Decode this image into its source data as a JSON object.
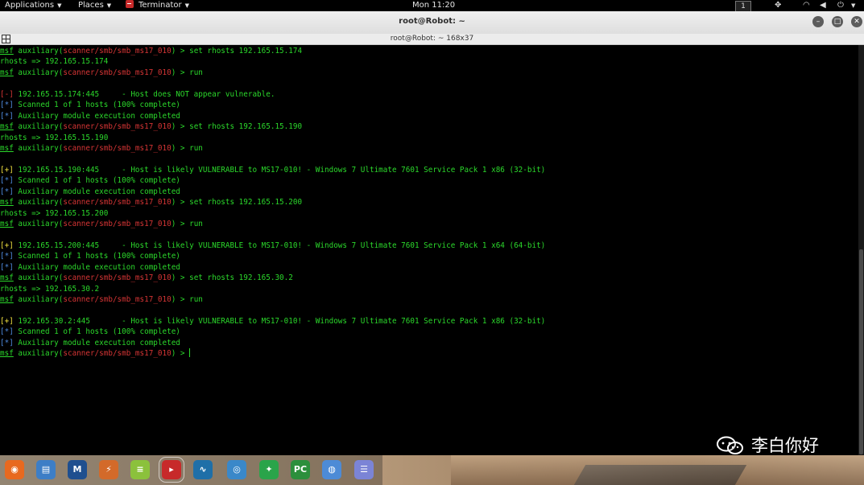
{
  "topbar": {
    "applications_label": "Applications",
    "places_label": "Places",
    "terminator_label": "Terminator",
    "clock": "Mon 11:20",
    "workspace": "1"
  },
  "window": {
    "title": "root@Robot: ~",
    "subtitle": "root@Robot: ~ 168x37"
  },
  "terminal": {
    "prompt_prefix": "msf",
    "module_word": "auxiliary",
    "module_path": "scanner/smb/smb_ms17_010",
    "lines": [
      {
        "kind": "prompt",
        "cmd": "set rhosts 192.165.15.174"
      },
      {
        "kind": "plain",
        "text": "rhosts => 192.165.15.174"
      },
      {
        "kind": "prompt",
        "cmd": "run"
      },
      {
        "kind": "blank"
      },
      {
        "kind": "tag",
        "tag": "[-]",
        "style": "err",
        "text": " 192.165.15.174:445     - Host does NOT appear vulnerable."
      },
      {
        "kind": "tag",
        "tag": "[*]",
        "style": "info",
        "text": " Scanned 1 of 1 hosts (100% complete)"
      },
      {
        "kind": "tag",
        "tag": "[*]",
        "style": "info",
        "text": " Auxiliary module execution completed"
      },
      {
        "kind": "prompt",
        "cmd": "set rhosts 192.165.15.190"
      },
      {
        "kind": "plain",
        "text": "rhosts => 192.165.15.190"
      },
      {
        "kind": "prompt",
        "cmd": "run"
      },
      {
        "kind": "blank"
      },
      {
        "kind": "tag",
        "tag": "[+]",
        "style": "good",
        "text": " 192.165.15.190:445     - Host is likely VULNERABLE to MS17-010! - Windows 7 Ultimate 7601 Service Pack 1 x86 (32-bit)"
      },
      {
        "kind": "tag",
        "tag": "[*]",
        "style": "info",
        "text": " Scanned 1 of 1 hosts (100% complete)"
      },
      {
        "kind": "tag",
        "tag": "[*]",
        "style": "info",
        "text": " Auxiliary module execution completed"
      },
      {
        "kind": "prompt",
        "cmd": "set rhosts 192.165.15.200"
      },
      {
        "kind": "plain",
        "text": "rhosts => 192.165.15.200"
      },
      {
        "kind": "prompt",
        "cmd": "run"
      },
      {
        "kind": "blank"
      },
      {
        "kind": "tag",
        "tag": "[+]",
        "style": "good",
        "text": " 192.165.15.200:445     - Host is likely VULNERABLE to MS17-010! - Windows 7 Ultimate 7601 Service Pack 1 x64 (64-bit)"
      },
      {
        "kind": "tag",
        "tag": "[*]",
        "style": "info",
        "text": " Scanned 1 of 1 hosts (100% complete)"
      },
      {
        "kind": "tag",
        "tag": "[*]",
        "style": "info",
        "text": " Auxiliary module execution completed"
      },
      {
        "kind": "prompt",
        "cmd": "set rhosts 192.165.30.2"
      },
      {
        "kind": "plain",
        "text": "rhosts => 192.165.30.2"
      },
      {
        "kind": "prompt",
        "cmd": "run"
      },
      {
        "kind": "blank"
      },
      {
        "kind": "tag",
        "tag": "[+]",
        "style": "good",
        "text": " 192.165.30.2:445       - Host is likely VULNERABLE to MS17-010! - Windows 7 Ultimate 7601 Service Pack 1 x86 (32-bit)"
      },
      {
        "kind": "tag",
        "tag": "[*]",
        "style": "info",
        "text": " Scanned 1 of 1 hosts (100% complete)"
      },
      {
        "kind": "tag",
        "tag": "[*]",
        "style": "info",
        "text": " Auxiliary module execution completed"
      },
      {
        "kind": "prompt",
        "cmd": "",
        "cursor": true
      }
    ]
  },
  "watermark": {
    "text": "李白你好"
  },
  "dock": {
    "apps": [
      {
        "name": "firefox-icon",
        "color": "#e8691f",
        "glyph": "◉"
      },
      {
        "name": "files-icon",
        "color": "#3d7ec6",
        "glyph": "▤"
      },
      {
        "name": "metasploit-icon",
        "color": "#1f4f8f",
        "glyph": "M"
      },
      {
        "name": "armitage-icon",
        "color": "#d36a2a",
        "glyph": "⚡"
      },
      {
        "name": "notes-icon",
        "color": "#8bc13c",
        "glyph": "≡"
      },
      {
        "name": "terminator-icon",
        "color": "#c72a2a",
        "glyph": "▸"
      },
      {
        "name": "wireshark-icon",
        "color": "#1f6fa8",
        "glyph": "∿"
      },
      {
        "name": "eye-icon",
        "color": "#3a88c9",
        "glyph": "◎"
      },
      {
        "name": "burp-icon",
        "color": "#2aa44a",
        "glyph": "✦"
      },
      {
        "name": "pycharm-icon",
        "color": "#2c8f3c",
        "glyph": "PC"
      },
      {
        "name": "chrome-icon",
        "color": "#4d8bd6",
        "glyph": "◍"
      },
      {
        "name": "text-editor-icon",
        "color": "#7b84d6",
        "glyph": "☰"
      }
    ]
  }
}
